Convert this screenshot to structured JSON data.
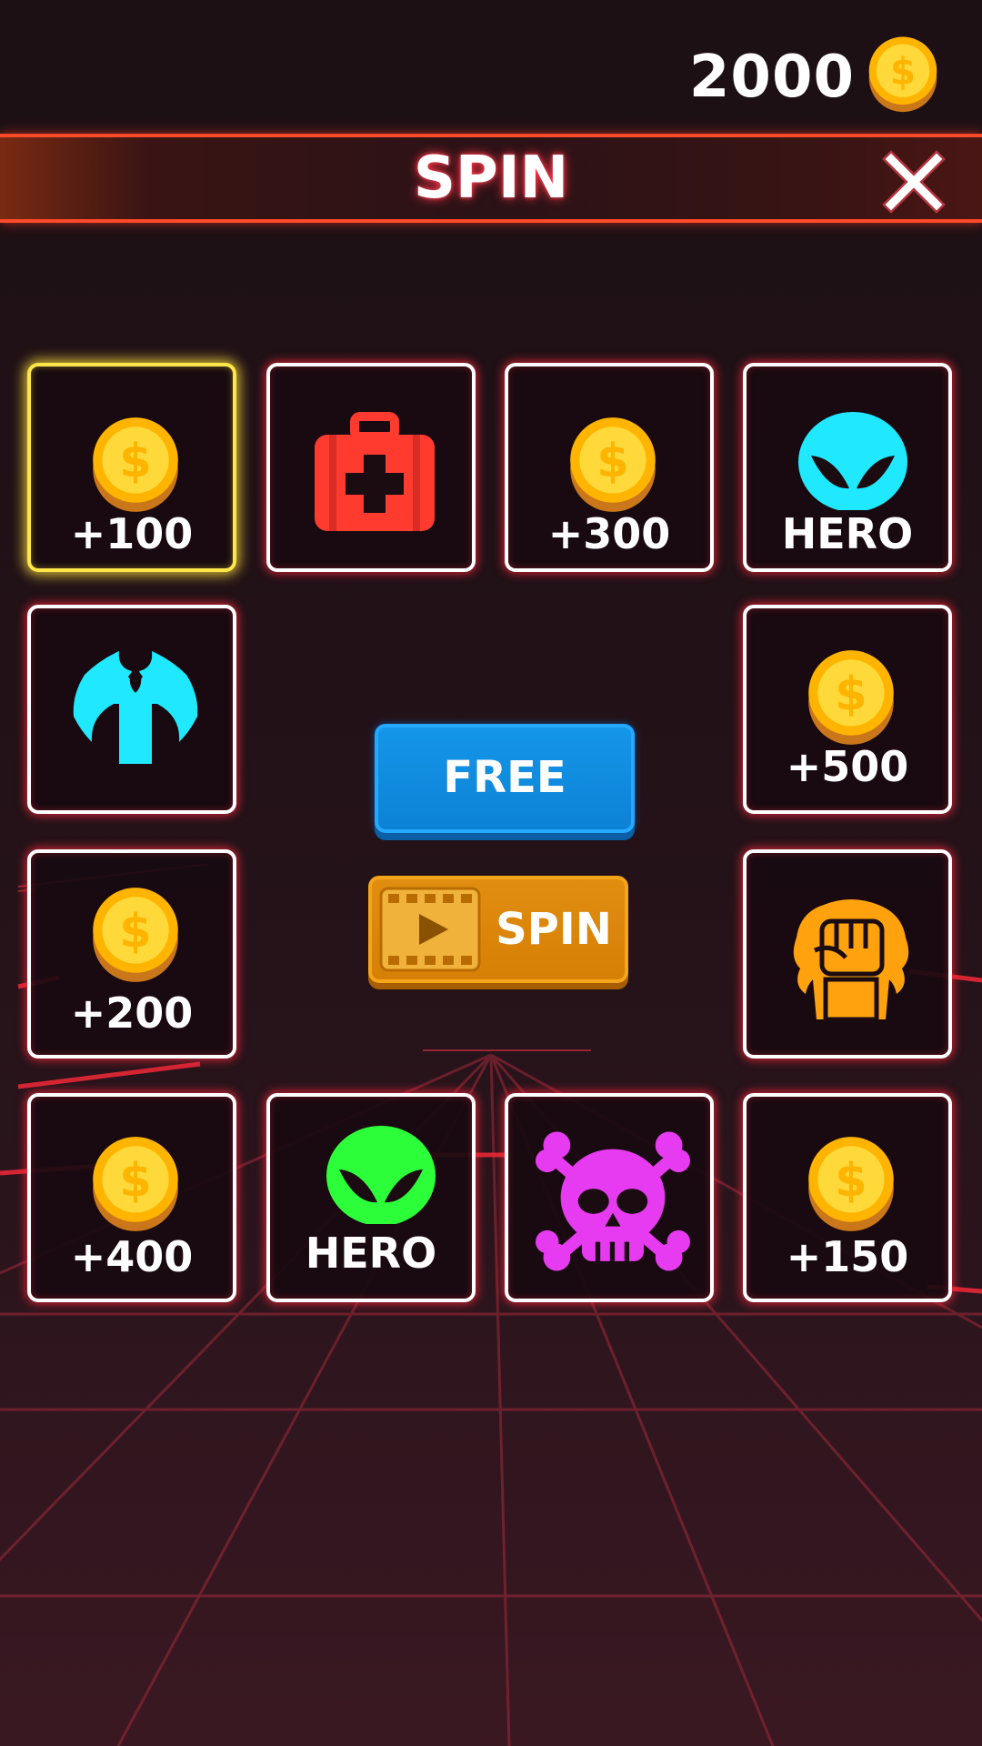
{
  "coins": {
    "balance": "2000",
    "icon": "coin-icon"
  },
  "header": {
    "title": "SPIN",
    "close_icon": "close-icon"
  },
  "tiles": [
    {
      "id": "coin-100",
      "icon": "coin-icon",
      "label": "+100",
      "selected": true
    },
    {
      "id": "medkit",
      "icon": "first-aid-kit-icon",
      "label": "",
      "color": "#ff3b30"
    },
    {
      "id": "coin-300",
      "icon": "coin-icon",
      "label": "+300"
    },
    {
      "id": "hero-cyan",
      "icon": "hero-mask-icon",
      "label": "HERO",
      "color": "#1fe8ff"
    },
    {
      "id": "axe",
      "icon": "battle-axe-icon",
      "label": "",
      "color": "#1fe8ff"
    },
    {
      "id": "coin-500",
      "icon": "coin-icon",
      "label": "+500"
    },
    {
      "id": "coin-200",
      "icon": "coin-icon",
      "label": "+200"
    },
    {
      "id": "fist",
      "icon": "raised-fist-icon",
      "label": "",
      "color": "#ffa20e"
    },
    {
      "id": "coin-400",
      "icon": "coin-icon",
      "label": "+400"
    },
    {
      "id": "hero-green",
      "icon": "hero-mask-icon",
      "label": "HERO",
      "color": "#2cff3a"
    },
    {
      "id": "skull",
      "icon": "skull-crossbones-icon",
      "label": "",
      "color": "#e63bf0"
    },
    {
      "id": "coin-150",
      "icon": "coin-icon",
      "label": "+150"
    }
  ],
  "buttons": {
    "free": {
      "label": "FREE",
      "color": "#0c82d6"
    },
    "video_spin": {
      "label": "SPIN",
      "icon": "video-play-icon",
      "color": "#d68006"
    }
  }
}
